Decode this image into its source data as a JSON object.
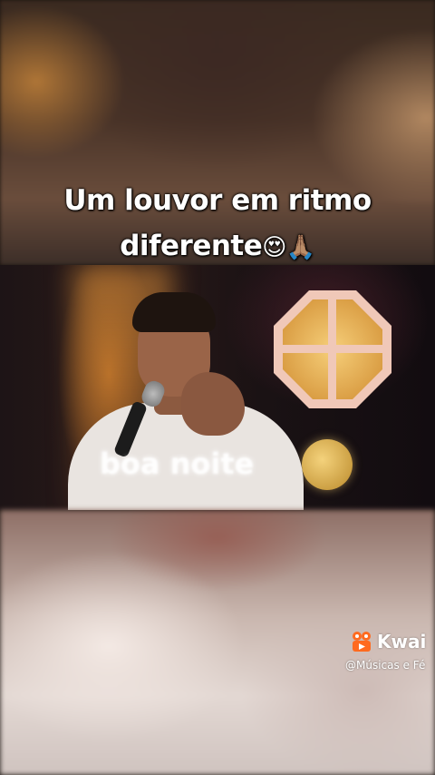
{
  "caption": {
    "line1": "Um louvor em ritmo",
    "line2": "diferente",
    "emoji": "😍🙏🏽"
  },
  "video": {
    "overlay_text": "boa noite"
  },
  "watermark": {
    "brand": "Kwai",
    "handle": "@Músicas e Fé",
    "brand_color": "#ff6a1f"
  }
}
